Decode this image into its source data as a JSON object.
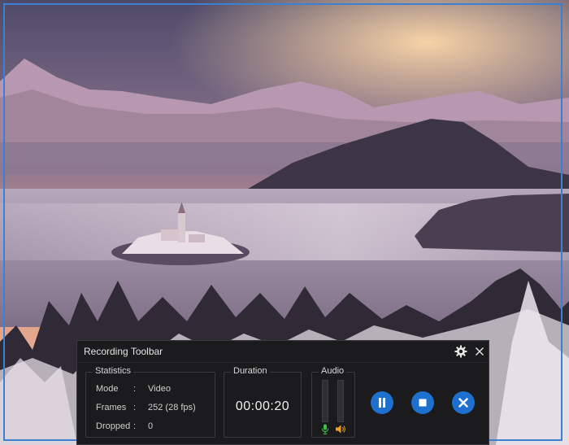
{
  "toolbar": {
    "title": "Recording Toolbar",
    "statistics": {
      "label": "Statistics",
      "rows": [
        {
          "key": "Mode",
          "sep": ":",
          "value": "Video"
        },
        {
          "key": "Frames",
          "sep": ":",
          "value": "252 (28 fps)"
        },
        {
          "key": "Dropped",
          "sep": ":",
          "value": "0"
        }
      ]
    },
    "duration": {
      "label": "Duration",
      "value": "00:00:20"
    },
    "audio": {
      "label": "Audio"
    }
  },
  "icons": {
    "settings": "gear-icon",
    "close": "close-icon",
    "microphone": "microphone-icon",
    "speaker": "speaker-icon",
    "pause": "pause-icon",
    "stop": "stop-icon",
    "cancel": "cancel-icon"
  },
  "colors": {
    "toolbar_bg": "#1b1b1d",
    "button_accent": "#1e70cf",
    "capture_frame": "#3d7fd1",
    "mic_color": "#3cc04a",
    "speaker_color": "#f0a020"
  }
}
